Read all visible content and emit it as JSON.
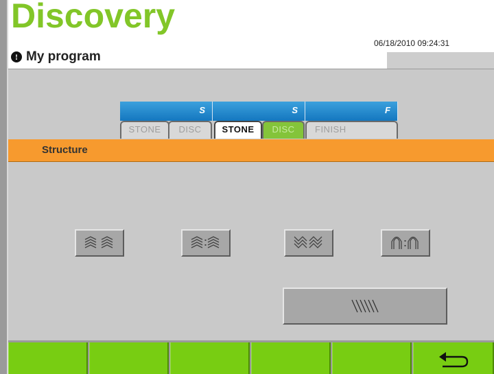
{
  "header": {
    "brand": "Discovery",
    "program_label": "My program",
    "datetime": "06/18/2010 09:24:31"
  },
  "tabs": {
    "groups": [
      {
        "letter": "S",
        "items": [
          "STONE",
          "DISC"
        ]
      },
      {
        "letter": "S",
        "items": [
          "STONE",
          "DISC"
        ]
      },
      {
        "letter": "F",
        "items": [
          "FINISH"
        ]
      }
    ],
    "active_group": 2
  },
  "section": {
    "title": "Structure"
  },
  "structure_buttons": [
    {
      "icon": "wave-outward-chevron-icon"
    },
    {
      "icon": "wave-outward-chevron-dotted-icon"
    },
    {
      "icon": "wave-zigzag-icon"
    },
    {
      "icon": "wave-arch-dotted-icon"
    },
    {
      "icon": "diagonal-lines-icon"
    }
  ],
  "footer": {
    "buttons": 6,
    "back_icon": "back-arrow-icon"
  },
  "colors": {
    "brand_green": "#82c628",
    "orange": "#f79a2e",
    "footer_green": "#78cd12",
    "tab_blue": "#1477bf"
  }
}
